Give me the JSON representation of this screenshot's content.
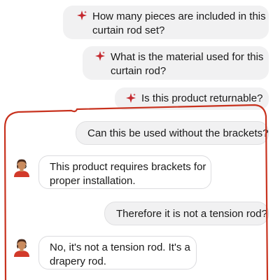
{
  "suggestions": [
    {
      "lines": [
        "How many pieces are included in this",
        "curtain rod set?"
      ],
      "icon": "sparkle-icon"
    },
    {
      "lines": [
        "What is the material used for this",
        "curtain rod?"
      ],
      "icon": "sparkle-icon"
    },
    {
      "lines": [
        "Is this product returnable?"
      ],
      "icon": "sparkle-icon"
    }
  ],
  "messages": [
    {
      "role": "user",
      "text": "Can this be used without the brackets?"
    },
    {
      "role": "agent",
      "lines": [
        "This product requires brackets for",
        "proper installation."
      ],
      "avatar": "agent-avatar"
    },
    {
      "role": "user",
      "text": "Therefore it is not a tension rod?"
    },
    {
      "role": "agent",
      "lines": [
        "No, it's not a tension rod. It's a",
        "drapery rod."
      ],
      "avatar": "agent-avatar"
    }
  ],
  "colors": {
    "sparkle": "#c4272d",
    "annotation": "#c8321e",
    "chip_bg": "#f1f1f2",
    "agent_shirt": "#d23a2a"
  }
}
